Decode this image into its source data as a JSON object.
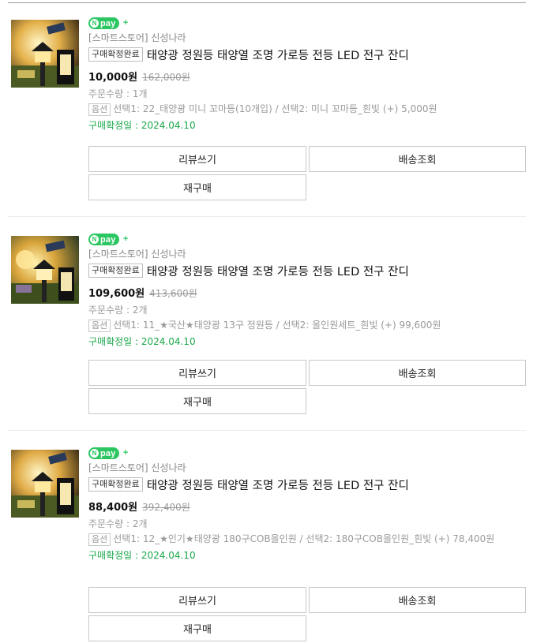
{
  "orders": [
    {
      "npay_label": "pay",
      "store": "[스마트스토어] 신성나라",
      "status": "구매확정완료",
      "title": "태양광 정원등 태양열 조명 가로등 전등 LED 전구 잔디",
      "price": "10,000원",
      "original_price": "162,000원",
      "quantity": "주문수량 : 1개",
      "option_label": "옵션",
      "option_text": "선택1: 22_태양광 미니 꼬마등(10개입) / 선택2: 미니 꼬마등_흰빛 (+) 5,000원",
      "confirm_date": "구매확정일 : 2024.04.10",
      "buttons": {
        "review": "리뷰쓰기",
        "shipping": "배송조회",
        "rebuy": "재구매"
      }
    },
    {
      "npay_label": "pay",
      "store": "[스마트스토어] 신성나라",
      "status": "구매확정완료",
      "title": "태양광 정원등 태양열 조명 가로등 전등 LED 전구 잔디",
      "price": "109,600원",
      "original_price": "413,600원",
      "quantity": "주문수량 : 2개",
      "option_label": "옵션",
      "option_text": "선택1: 11_★국산★태양광 13구 정원등 / 선택2: 올인원세트_흰빛 (+) 99,600원",
      "confirm_date": "구매확정일 : 2024.04.10",
      "buttons": {
        "review": "리뷰쓰기",
        "shipping": "배송조회",
        "rebuy": "재구매"
      }
    },
    {
      "npay_label": "pay",
      "store": "[스마트스토어] 신성나라",
      "status": "구매확정완료",
      "title": "태양광 정원등 태양열 조명 가로등 전등 LED 전구 잔디",
      "price": "88,400원",
      "original_price": "392,400원",
      "quantity": "주문수량 : 2개",
      "option_label": "옵션",
      "option_text": "선택1: 12_★인기★태양광 180구COB올인원 / 선택2: 180구COB올인원_흰빛 (+) 78,400원",
      "confirm_date": "구매확정일 : 2024.04.10",
      "buttons": {
        "review": "리뷰쓰기",
        "shipping": "배송조회",
        "rebuy": "재구매"
      }
    }
  ],
  "colors": {
    "npay_green": "#2bc661",
    "confirm_green": "#1aa84b",
    "muted_gray": "#9a9a9a"
  },
  "icons": [
    "npay-logo-icon",
    "plus-icon",
    "product-thumbnail"
  ]
}
